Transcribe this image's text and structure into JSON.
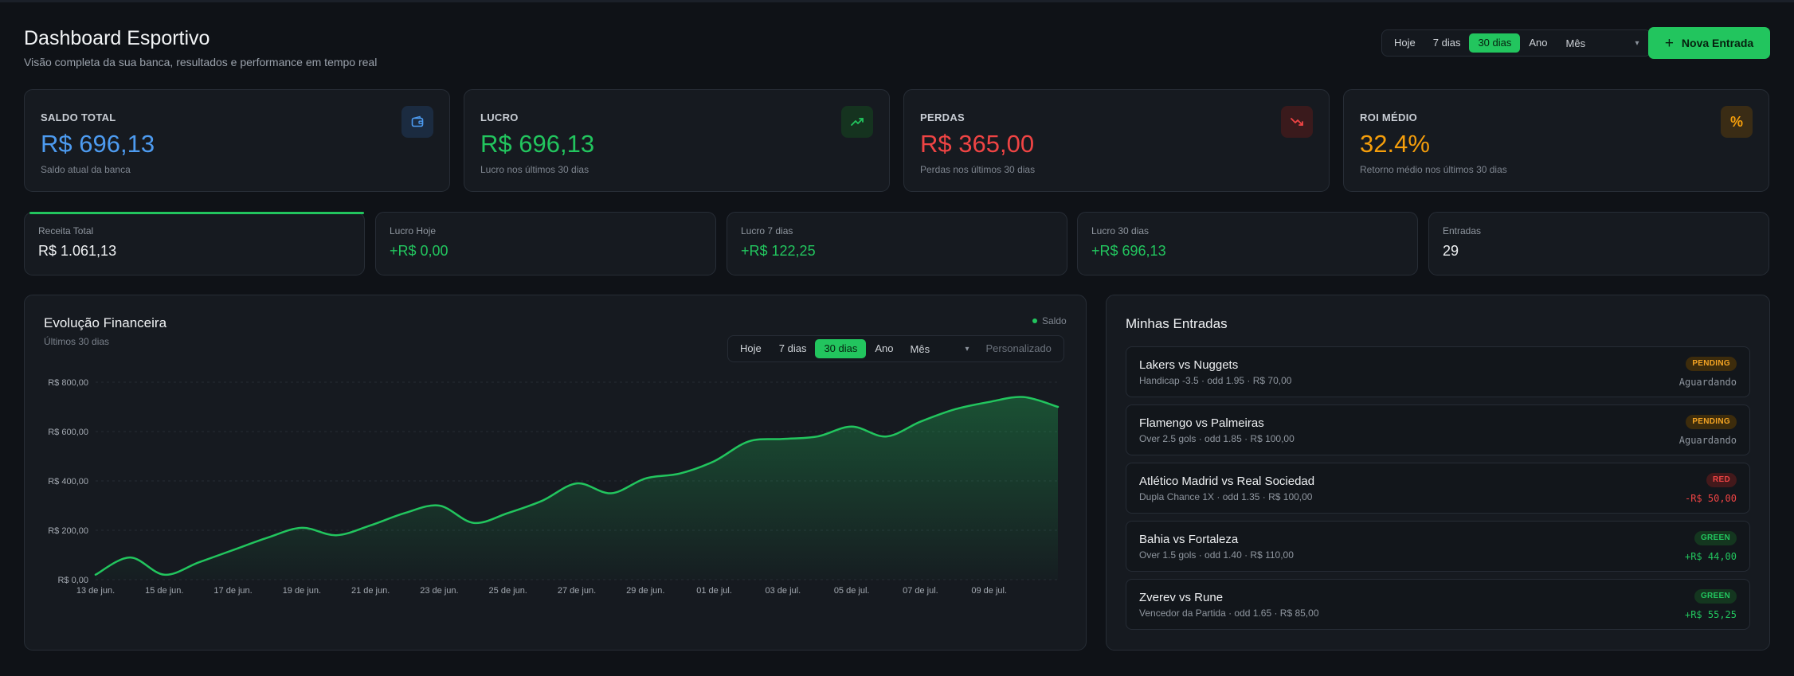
{
  "header": {
    "title": "Dashboard Esportivo",
    "subtitle": "Visão completa da sua banca, resultados e performance em tempo real",
    "periods": [
      "Hoje",
      "7 dias",
      "30 dias",
      "Ano"
    ],
    "active_period": "30 dias",
    "month_select": "Mês",
    "new_entry_label": "Nova Entrada"
  },
  "stats": [
    {
      "label": "SALDO TOTAL",
      "value": "R$ 696,13",
      "desc": "Saldo atual da banca",
      "icon": "wallet-icon",
      "color": "#4d9bf0"
    },
    {
      "label": "LUCRO",
      "value": "R$ 696,13",
      "desc": "Lucro nos últimos 30 dias",
      "icon": "trending-up-icon",
      "color": "#22c55e"
    },
    {
      "label": "PERDAS",
      "value": "R$ 365,00",
      "desc": "Perdas nos últimos 30 dias",
      "icon": "trending-down-icon",
      "color": "#ef4444"
    },
    {
      "label": "ROI MÉDIO",
      "value": "32.4%",
      "desc": "Retorno médio nos últimos 30 dias",
      "icon": "percent-icon",
      "color": "#f59e0b"
    }
  ],
  "mini_stats": [
    {
      "label": "Receita Total",
      "value": "R$ 1.061,13"
    },
    {
      "label": "Lucro Hoje",
      "value": "+R$ 0,00"
    },
    {
      "label": "Lucro 7 dias",
      "value": "+R$ 122,25"
    },
    {
      "label": "Lucro 30 dias",
      "value": "+R$ 696,13"
    },
    {
      "label": "Entradas",
      "value": "29"
    }
  ],
  "chart_panel": {
    "title": "Evolução Financeira",
    "subtitle": "Últimos 30 dias",
    "periods": [
      "Hoje",
      "7 dias",
      "30 dias",
      "Ano"
    ],
    "active_period": "30 dias",
    "month_select": "Mês",
    "custom_label": "Personalizado"
  },
  "chart_data": {
    "type": "area",
    "series": [
      {
        "name": "Saldo",
        "values": [
          20,
          90,
          20,
          70,
          120,
          170,
          210,
          180,
          220,
          270,
          300,
          230,
          270,
          320,
          390,
          350,
          410,
          430,
          480,
          560,
          570,
          580,
          620,
          580,
          640,
          690,
          720,
          740,
          700
        ]
      }
    ],
    "x": [
      "13 de jun.",
      "14 de jun.",
      "15 de jun.",
      "16 de jun.",
      "17 de jun.",
      "18 de jun.",
      "19 de jun.",
      "20 de jun.",
      "21 de jun.",
      "22 de jun.",
      "23 de jun.",
      "24 de jun.",
      "25 de jun.",
      "26 de jun.",
      "27 de jun.",
      "28 de jun.",
      "29 de jun.",
      "30 de jun.",
      "01 de jul.",
      "02 de jul.",
      "03 de jul.",
      "04 de jul.",
      "05 de jul.",
      "06 de jul.",
      "07 de jul.",
      "08 de jul.",
      "09 de jul.",
      "10 de jul.",
      "11 de jul."
    ],
    "x_ticks": [
      "13 de jun.",
      "15 de jun.",
      "17 de jun.",
      "19 de jun.",
      "21 de jun.",
      "23 de jun.",
      "25 de jun.",
      "27 de jun.",
      "29 de jun.",
      "01 de jul.",
      "03 de jul.",
      "05 de jul.",
      "07 de jul.",
      "09 de jul."
    ],
    "y_ticks": [
      "R$ 0,00",
      "R$ 200,00",
      "R$ 400,00",
      "R$ 600,00",
      "R$ 800,00"
    ],
    "ylim": [
      0,
      800
    ],
    "grid": true,
    "legend": "top-right",
    "color": "#22c55e"
  },
  "entries_panel": {
    "title": "Minhas Entradas",
    "items": [
      {
        "match": "Lakers vs Nuggets",
        "detail": "Handicap -3.5 · odd 1.95 · R$ 70,00",
        "status": "PENDING",
        "result": "Aguardando"
      },
      {
        "match": "Flamengo vs Palmeiras",
        "detail": "Over 2.5 gols · odd 1.85 · R$ 100,00",
        "status": "PENDING",
        "result": "Aguardando"
      },
      {
        "match": "Atlético Madrid vs Real Sociedad",
        "detail": "Dupla Chance 1X · odd 1.35 · R$ 100,00",
        "status": "RED",
        "result": "-R$ 50,00"
      },
      {
        "match": "Bahia vs Fortaleza",
        "detail": "Over 1.5 gols · odd 1.40 · R$ 110,00",
        "status": "GREEN",
        "result": "+R$ 44,00"
      },
      {
        "match": "Zverev vs Rune",
        "detail": "Vencedor da Partida · odd 1.65 · R$ 85,00",
        "status": "GREEN",
        "result": "+R$ 55,25"
      }
    ]
  }
}
